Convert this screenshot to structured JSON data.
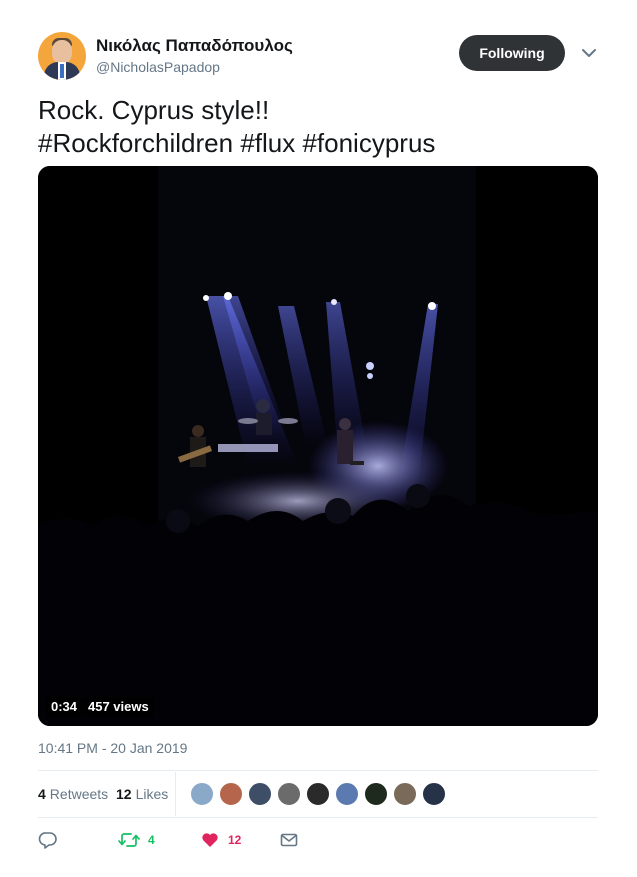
{
  "author": {
    "display_name": "Νικόλας Παπαδόπουλος",
    "handle": "@NicholasPapadop"
  },
  "follow_button_label": "Following",
  "tweet": {
    "line1": "Rock. Cyprus style!!",
    "line2": "#Rockforchildren #flux #fonicyprus"
  },
  "video": {
    "duration": "0:34",
    "views": "457 views"
  },
  "timestamp": "10:41 PM - 20 Jan 2019",
  "stats": {
    "retweets_count": "4",
    "retweets_label": "Retweets",
    "likes_count": "12",
    "likes_label": "Likes"
  },
  "liker_avatars": [
    "#8aa8c8",
    "#b5654b",
    "#3d4e66",
    "#6b6b6b",
    "#2a2a2a",
    "#5b7bb0",
    "#1e2a1e",
    "#7a6a5a",
    "#263248"
  ],
  "actions": {
    "reply_icon": "reply-icon",
    "retweet_icon": "retweet-icon",
    "retweet_count": "4",
    "like_icon": "heart-icon",
    "like_count": "12",
    "dm_icon": "envelope-icon"
  },
  "colors": {
    "follow_bg": "#2f3336",
    "retweet": "#17bf63",
    "like": "#e0245e",
    "secondary_text": "#657786",
    "link_blue": "#1da1f2"
  }
}
